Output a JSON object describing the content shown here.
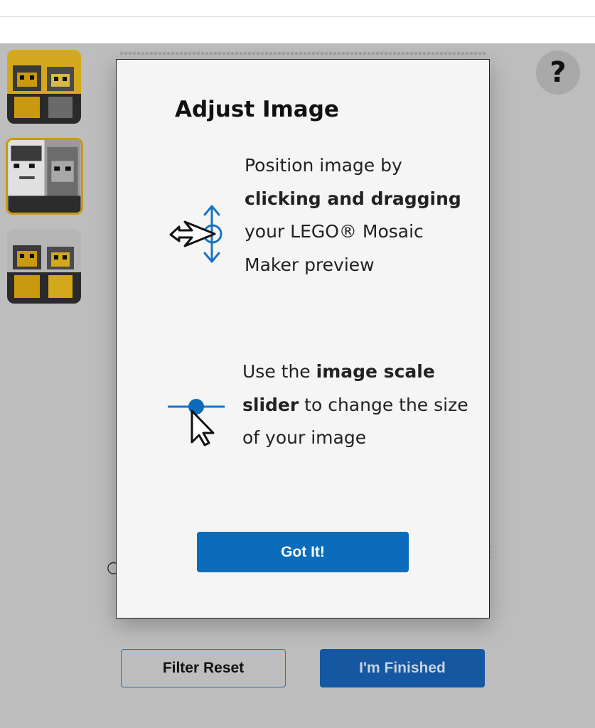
{
  "help": {
    "label": "?"
  },
  "modal": {
    "title": "Adjust Image",
    "step1": {
      "pre": "Position image by ",
      "bold1": "clicking and dragging",
      "mid": " your LEGO® Mosaic Maker preview"
    },
    "step2": {
      "pre": "Use the ",
      "bold1": "image scale slider",
      "post": " to change the size of your image"
    },
    "button": "Got It!"
  },
  "footer": {
    "reset_label": "Filter Reset",
    "finish_label": "I'm Finished"
  },
  "colors": {
    "accent_blue": "#0a6cba",
    "finish_blue": "#1558a1",
    "backdrop": "#bdbdbd",
    "thumb_yellow": "#d4a81c"
  },
  "thumbnails": [
    {
      "name": "yellow-mosaic",
      "selected": false
    },
    {
      "name": "grayscale-mosaic",
      "selected": true
    },
    {
      "name": "yellow-gray-mosaic",
      "selected": false
    }
  ]
}
